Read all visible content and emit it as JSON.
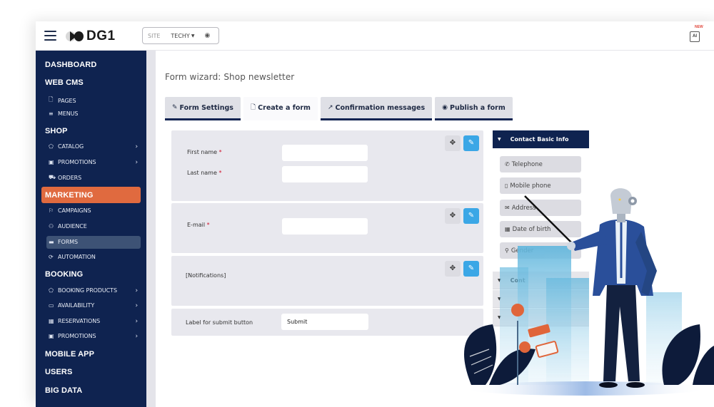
{
  "header": {
    "logo_text": "DG1",
    "site_label": "SITE",
    "site_value": "TECHY",
    "ai_badge": "NEW",
    "ai_icon_text": "AI"
  },
  "sidebar": {
    "sections": [
      {
        "label": "DASHBOARD"
      },
      {
        "label": "WEB CMS",
        "items": [
          {
            "label": "PAGES",
            "icon": "page-icon"
          },
          {
            "label": "MENUS",
            "icon": "menu-icon"
          }
        ]
      },
      {
        "label": "SHOP",
        "items": [
          {
            "label": "CATALOG",
            "icon": "tag-icon",
            "has_children": true
          },
          {
            "label": "PROMOTIONS",
            "icon": "gift-icon",
            "has_children": true
          },
          {
            "label": "ORDERS",
            "icon": "cart-icon"
          }
        ]
      },
      {
        "label": "MARKETING",
        "active": true,
        "items": [
          {
            "label": "CAMPAIGNS",
            "icon": "flag-icon"
          },
          {
            "label": "AUDIENCE",
            "icon": "users-icon"
          },
          {
            "label": "FORMS",
            "icon": "form-icon",
            "active": true
          },
          {
            "label": "AUTOMATION",
            "icon": "refresh-icon"
          }
        ]
      },
      {
        "label": "BOOKING",
        "items": [
          {
            "label": "BOOKING PRODUCTS",
            "icon": "tag-icon",
            "has_children": true
          },
          {
            "label": "AVAILABILITY",
            "icon": "calendar-icon",
            "has_children": true
          },
          {
            "label": "RESERVATIONS",
            "icon": "calendar-grid-icon",
            "has_children": true
          },
          {
            "label": "PROMOTIONS",
            "icon": "gift-icon",
            "has_children": true
          }
        ]
      },
      {
        "label": "MOBILE APP"
      },
      {
        "label": "USERS"
      },
      {
        "label": "BIG DATA"
      }
    ]
  },
  "main": {
    "title": "Form wizard: Shop newsletter",
    "tabs": [
      {
        "label": "Form Settings",
        "icon": "edit-icon"
      },
      {
        "label": "Create a form",
        "icon": "page-icon",
        "active": true
      },
      {
        "label": "Confirmation messages",
        "icon": "share-icon"
      },
      {
        "label": "Publish a form",
        "icon": "eye-icon"
      }
    ],
    "form_blocks": {
      "name_block": {
        "first_name_label": "First name",
        "last_name_label": "Last name",
        "required_mark": "*",
        "first_name_value": "",
        "last_name_value": ""
      },
      "email_block": {
        "email_label": "E-mail",
        "required_mark": "*",
        "email_value": ""
      },
      "notifications_block": {
        "label": "[Notifications]"
      },
      "submit_block": {
        "label": "Label for submit button",
        "value": "Submit"
      }
    },
    "palette": {
      "header": "Contact Basic Info",
      "items": [
        {
          "label": "Telephone",
          "icon": "phone-icon"
        },
        {
          "label": "Mobile phone",
          "icon": "mobile-icon"
        },
        {
          "label": "Address",
          "icon": "envelope-icon"
        },
        {
          "label": "Date of birth",
          "icon": "calendar-icon"
        },
        {
          "label": "Gender",
          "icon": "gender-icon"
        }
      ],
      "collapsed_sections": [
        {
          "label": "Cont"
        },
        {
          "label": ""
        },
        {
          "label": ""
        }
      ]
    }
  }
}
